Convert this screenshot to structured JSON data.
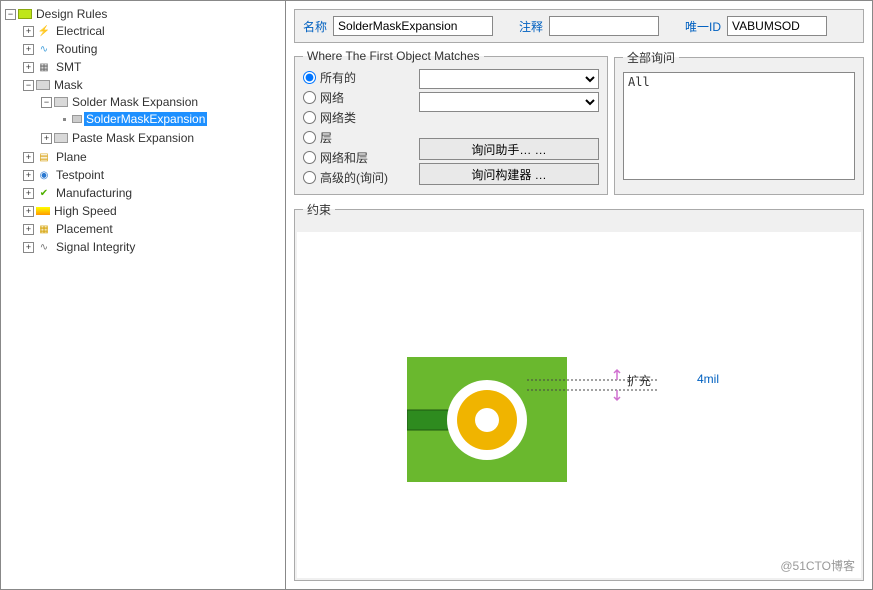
{
  "tree": {
    "root": "Design Rules",
    "electrical": "Electrical",
    "routing": "Routing",
    "smt": "SMT",
    "mask": "Mask",
    "solder_mask_expansion": "Solder Mask Expansion",
    "solder_mask_expansion_leaf": "SolderMaskExpansion",
    "paste_mask_expansion": "Paste Mask Expansion",
    "plane": "Plane",
    "testpoint": "Testpoint",
    "manufacturing": "Manufacturing",
    "high_speed": "High Speed",
    "placement": "Placement",
    "signal_integrity": "Signal Integrity"
  },
  "header": {
    "name_label": "名称",
    "name_value": "SolderMaskExpansion",
    "comment_label": "注释",
    "comment_value": "",
    "uid_label": "唯一ID",
    "uid_value": "VABUMSOD"
  },
  "matches": {
    "legend": "Where The First Object Matches",
    "opts": [
      "所有的",
      "网络",
      "网络类",
      "层",
      "网络和层",
      "高级的(询问)"
    ],
    "assistant_btn": "询问助手… …",
    "builder_btn": "询问构建器 …"
  },
  "query": {
    "legend": "全部询问",
    "text": "All"
  },
  "constraint": {
    "legend": "约束",
    "expand_label": "扩充",
    "expand_value": "4mil"
  },
  "watermark": "@51CTO博客"
}
